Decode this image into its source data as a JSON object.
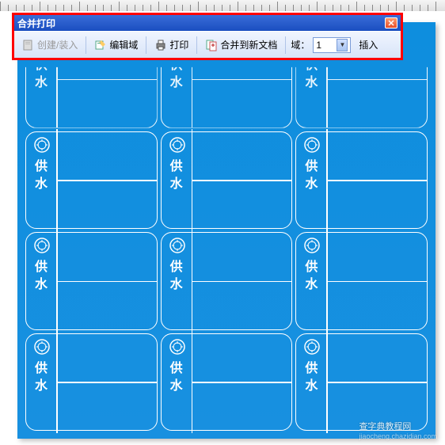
{
  "window": {
    "title": "合并打印"
  },
  "toolbar": {
    "create_load": "创建/装入",
    "edit_field": "编辑域",
    "print": "打印",
    "merge_new_doc": "合并到新文档",
    "field_label": "域：",
    "field_value": "1",
    "insert": "插入"
  },
  "card": {
    "label": "供水"
  },
  "watermark": {
    "main": "查字典教程网",
    "sub": "jiaocheng.chazidian.com"
  }
}
